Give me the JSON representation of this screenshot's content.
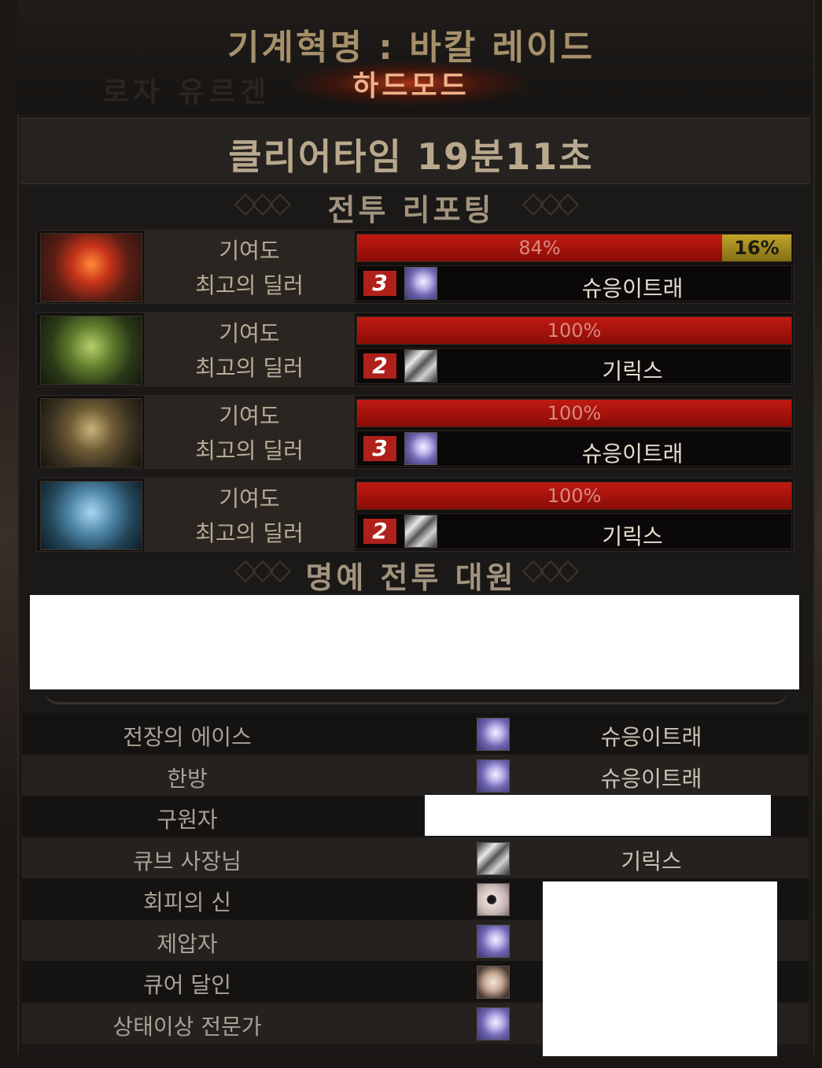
{
  "header": {
    "ghost_text": "로자 유르겐",
    "raid_title": "기계혁명 : 바칼 레이드",
    "raid_mode": "하드모드"
  },
  "clear_time": "클리어타임  19분11초",
  "battle_report": {
    "title": "전투 리포팅",
    "contribution_label": "기여도",
    "top_dealer_label": "최고의 딜러",
    "parties": [
      {
        "portrait": "fire-crest-icon",
        "segments": [
          {
            "percent": 84,
            "label": "84%",
            "color": "#b01810"
          },
          {
            "percent": 16,
            "label": "16%",
            "color": "#a89020"
          }
        ],
        "rank": "3",
        "class_icon": "moon-class-icon",
        "dealer": "슈응이트래"
      },
      {
        "portrait": "green-crest-icon",
        "segments": [
          {
            "percent": 100,
            "label": "100%",
            "color": "#b01810"
          }
        ],
        "rank": "2",
        "class_icon": "blade-class-icon",
        "dealer": "기릭스"
      },
      {
        "portrait": "gold-crest-icon",
        "segments": [
          {
            "percent": 100,
            "label": "100%",
            "color": "#b01810"
          }
        ],
        "rank": "3",
        "class_icon": "moon-class-icon",
        "dealer": "슈응이트래"
      },
      {
        "portrait": "blue-crest-icon",
        "segments": [
          {
            "percent": 100,
            "label": "100%",
            "color": "#b01810"
          }
        ],
        "rank": "2",
        "class_icon": "blade-class-icon",
        "dealer": "기릭스"
      }
    ]
  },
  "honor": {
    "title": "명예 전투 대원"
  },
  "awards": [
    {
      "label": "전장의 에이스",
      "icon": "moon-class-icon",
      "name": "슈응이트래"
    },
    {
      "label": "한방",
      "icon": "moon-class-icon",
      "name": "슈응이트래"
    },
    {
      "label": "구원자",
      "icon": "",
      "name": ""
    },
    {
      "label": "큐브 사장님",
      "icon": "blade-class-icon",
      "name": "기릭스"
    },
    {
      "label": "회피의 신",
      "icon": "eye-class-icon",
      "name": ""
    },
    {
      "label": "제압자",
      "icon": "moon-class-icon",
      "name": ""
    },
    {
      "label": "큐어 달인",
      "icon": "face-class-icon",
      "name": ""
    },
    {
      "label": "상태이상 전문가",
      "icon": "moon-class-icon",
      "name": ""
    }
  ],
  "colors": {
    "contribution_red": "#b01810",
    "contribution_gold": "#a89020",
    "rank_badge": "#b0201a",
    "mode_glow": "#d23c14"
  }
}
